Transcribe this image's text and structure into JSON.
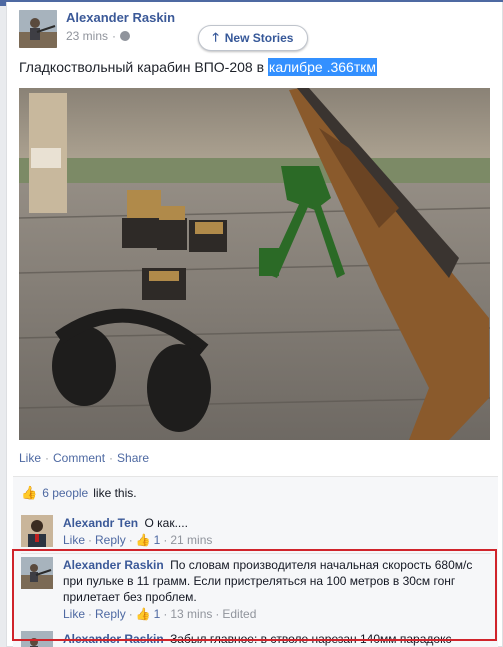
{
  "post": {
    "author": "Alexander Raskin",
    "time": "23 mins",
    "text_prefix": "Гладкоствольный карабин ВПО-208 в ",
    "text_highlight": "калибре .366ткм"
  },
  "new_stories": {
    "label": "New Stories"
  },
  "actions": {
    "like": "Like",
    "comment": "Comment",
    "share": "Share",
    "dot": "·"
  },
  "likes": {
    "people": "6 people",
    "suffix": "like this."
  },
  "comments": [
    {
      "author": "Alexandr Ten",
      "text": "О как....",
      "like": "Like",
      "reply": "Reply",
      "likes": "1",
      "time": "21 mins",
      "edited": ""
    },
    {
      "author": "Alexander Raskin",
      "text": "По словам производителя начальная скорость 680м/с при пульке в 11 грамм. Если пристреляться на 100 метров в 30см гонг прилетает без проблем.",
      "like": "Like",
      "reply": "Reply",
      "likes": "1",
      "time": "13 mins",
      "edited": "Edited"
    },
    {
      "author": "Alexander Raskin",
      "text": "Забыл главное: в стволе нарезан 140мм парадокс"
    }
  ],
  "icons": {
    "globe": "globe-icon",
    "arrow": "arrow-up-icon",
    "thumb": "thumbs-up-icon"
  },
  "colors": {
    "link": "#4e69a2",
    "name": "#3b5998",
    "highlight": "#3390ff",
    "annotation": "#d0242b"
  }
}
